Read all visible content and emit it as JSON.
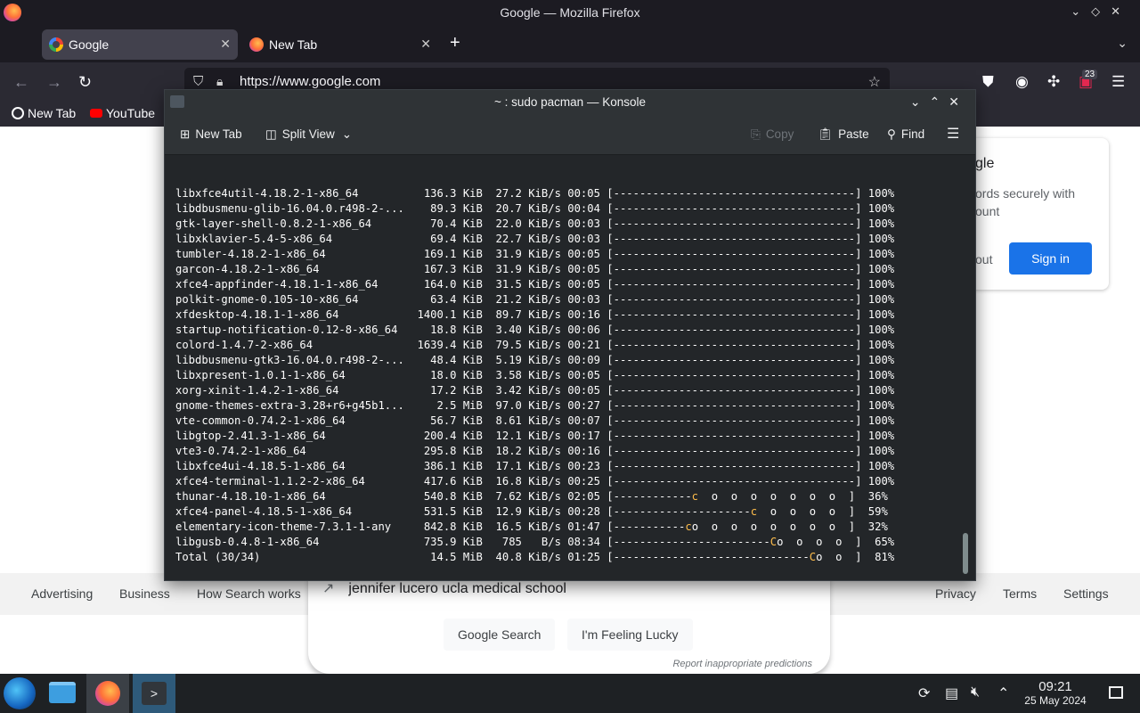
{
  "firefox": {
    "window_title": "Google — Mozilla Firefox",
    "tabs": [
      {
        "label": "Google",
        "active": true
      },
      {
        "label": "New Tab",
        "active": false
      }
    ],
    "url": "https://www.google.com",
    "toolbar_badge": "23",
    "bookmarks": [
      {
        "label": "New Tab",
        "icon": "firefox-icon"
      },
      {
        "label": "YouTube",
        "icon": "youtube-icon"
      }
    ]
  },
  "google": {
    "signin_card": {
      "title": "gle",
      "desc": "ords securely with ount",
      "later": "out",
      "signin": "Sign in"
    },
    "suggestion": "jennifer lucero ucla medical school",
    "search_button": "Google Search",
    "lucky_button": "I'm Feeling Lucky",
    "report": "Report inappropriate predictions",
    "footer_left": [
      "Advertising",
      "Business",
      "How Search works"
    ],
    "footer_right": [
      "Privacy",
      "Terms",
      "Settings"
    ]
  },
  "konsole": {
    "title": "~ : sudo pacman — Konsole",
    "toolbar": {
      "new_tab": "New Tab",
      "split_view": "Split View",
      "copy": "Copy",
      "paste": "Paste",
      "find": "Find"
    },
    "rows": [
      {
        "name": "libxfce4util-4.18.2-1-x86_64",
        "size": "136.3 KiB",
        "speed": "27.2 KiB/s",
        "time": "00:05",
        "bar": "[-------------------------------------]",
        "pct": "100%"
      },
      {
        "name": "libdbusmenu-glib-16.04.0.r498-2-...",
        "size": "89.3 KiB",
        "speed": "20.7 KiB/s",
        "time": "00:04",
        "bar": "[-------------------------------------]",
        "pct": "100%"
      },
      {
        "name": "gtk-layer-shell-0.8.2-1-x86_64",
        "size": "70.4 KiB",
        "speed": "22.0 KiB/s",
        "time": "00:03",
        "bar": "[-------------------------------------]",
        "pct": "100%"
      },
      {
        "name": "libxklavier-5.4-5-x86_64",
        "size": "69.4 KiB",
        "speed": "22.7 KiB/s",
        "time": "00:03",
        "bar": "[-------------------------------------]",
        "pct": "100%"
      },
      {
        "name": "tumbler-4.18.2-1-x86_64",
        "size": "169.1 KiB",
        "speed": "31.9 KiB/s",
        "time": "00:05",
        "bar": "[-------------------------------------]",
        "pct": "100%"
      },
      {
        "name": "garcon-4.18.2-1-x86_64",
        "size": "167.3 KiB",
        "speed": "31.9 KiB/s",
        "time": "00:05",
        "bar": "[-------------------------------------]",
        "pct": "100%"
      },
      {
        "name": "xfce4-appfinder-4.18.1-1-x86_64",
        "size": "164.0 KiB",
        "speed": "31.5 KiB/s",
        "time": "00:05",
        "bar": "[-------------------------------------]",
        "pct": "100%"
      },
      {
        "name": "polkit-gnome-0.105-10-x86_64",
        "size": "63.4 KiB",
        "speed": "21.2 KiB/s",
        "time": "00:03",
        "bar": "[-------------------------------------]",
        "pct": "100%"
      },
      {
        "name": "xfdesktop-4.18.1-1-x86_64",
        "size": "1400.1 KiB",
        "speed": "89.7 KiB/s",
        "time": "00:16",
        "bar": "[-------------------------------------]",
        "pct": "100%"
      },
      {
        "name": "startup-notification-0.12-8-x86_64",
        "size": "18.8 KiB",
        "speed": "3.40 KiB/s",
        "time": "00:06",
        "bar": "[-------------------------------------]",
        "pct": "100%"
      },
      {
        "name": "colord-1.4.7-2-x86_64",
        "size": "1639.4 KiB",
        "speed": "79.5 KiB/s",
        "time": "00:21",
        "bar": "[-------------------------------------]",
        "pct": "100%"
      },
      {
        "name": "libdbusmenu-gtk3-16.04.0.r498-2-...",
        "size": "48.4 KiB",
        "speed": "5.19 KiB/s",
        "time": "00:09",
        "bar": "[-------------------------------------]",
        "pct": "100%"
      },
      {
        "name": "libxpresent-1.0.1-1-x86_64",
        "size": "18.0 KiB",
        "speed": "3.58 KiB/s",
        "time": "00:05",
        "bar": "[-------------------------------------]",
        "pct": "100%"
      },
      {
        "name": "xorg-xinit-1.4.2-1-x86_64",
        "size": "17.2 KiB",
        "speed": "3.42 KiB/s",
        "time": "00:05",
        "bar": "[-------------------------------------]",
        "pct": "100%"
      },
      {
        "name": "gnome-themes-extra-3.28+r6+g45b1...",
        "size": "2.5 MiB",
        "speed": "97.0 KiB/s",
        "time": "00:27",
        "bar": "[-------------------------------------]",
        "pct": "100%"
      },
      {
        "name": "vte-common-0.74.2-1-x86_64",
        "size": "56.7 KiB",
        "speed": "8.61 KiB/s",
        "time": "00:07",
        "bar": "[-------------------------------------]",
        "pct": "100%"
      },
      {
        "name": "libgtop-2.41.3-1-x86_64",
        "size": "200.4 KiB",
        "speed": "12.1 KiB/s",
        "time": "00:17",
        "bar": "[-------------------------------------]",
        "pct": "100%"
      },
      {
        "name": "vte3-0.74.2-1-x86_64",
        "size": "295.8 KiB",
        "speed": "18.2 KiB/s",
        "time": "00:16",
        "bar": "[-------------------------------------]",
        "pct": "100%"
      },
      {
        "name": "libxfce4ui-4.18.5-1-x86_64",
        "size": "386.1 KiB",
        "speed": "17.1 KiB/s",
        "time": "00:23",
        "bar": "[-------------------------------------]",
        "pct": "100%"
      },
      {
        "name": "xfce4-terminal-1.1.2-2-x86_64",
        "size": "417.6 KiB",
        "speed": "16.8 KiB/s",
        "time": "00:25",
        "bar": "[-------------------------------------]",
        "pct": "100%"
      },
      {
        "name": "thunar-4.18.10-1-x86_64",
        "size": "540.8 KiB",
        "speed": "7.62 KiB/s",
        "time": "02:05",
        "bar_done": "[------------",
        "bar_pac": "c",
        "bar_rest": "  o  o  o  o  o  o  o  ]",
        "pct": "36%"
      },
      {
        "name": "xfce4-panel-4.18.5-1-x86_64",
        "size": "531.5 KiB",
        "speed": "12.9 KiB/s",
        "time": "00:28",
        "bar_done": "[---------------------",
        "bar_pac": "c",
        "bar_rest": "  o  o  o  o  ]",
        "pct": "59%"
      },
      {
        "name": "elementary-icon-theme-7.3.1-1-any",
        "size": "842.8 KiB",
        "speed": "16.5 KiB/s",
        "time": "01:47",
        "bar_done": "[-----------",
        "bar_pac": "c",
        "bar_rest": "o  o  o  o  o  o  o  o  ]",
        "pct": "32%"
      },
      {
        "name": "libgusb-0.4.8-1-x86_64",
        "size": "735.9 KiB",
        "speed": "785   B/s",
        "time": "08:34",
        "bar_done": "[------------------------",
        "bar_pac": "C",
        "bar_rest": "o  o  o  o  ]",
        "pct": "65%"
      },
      {
        "name": "Total (30/34)",
        "size": "14.5 MiB",
        "speed": "40.8 KiB/s",
        "time": "01:25",
        "bar_done": "[------------------------------",
        "bar_pac": "C",
        "bar_rest": "o  o  ]",
        "pct": "81%"
      }
    ]
  },
  "taskbar": {
    "time": "09:21",
    "date": "25 May 2024"
  },
  "colors": {
    "terminal_bg": "#232629",
    "pacman": "#fdbc4b",
    "firefox_dark": "#1c1b22",
    "google_blue": "#1a73e8"
  }
}
